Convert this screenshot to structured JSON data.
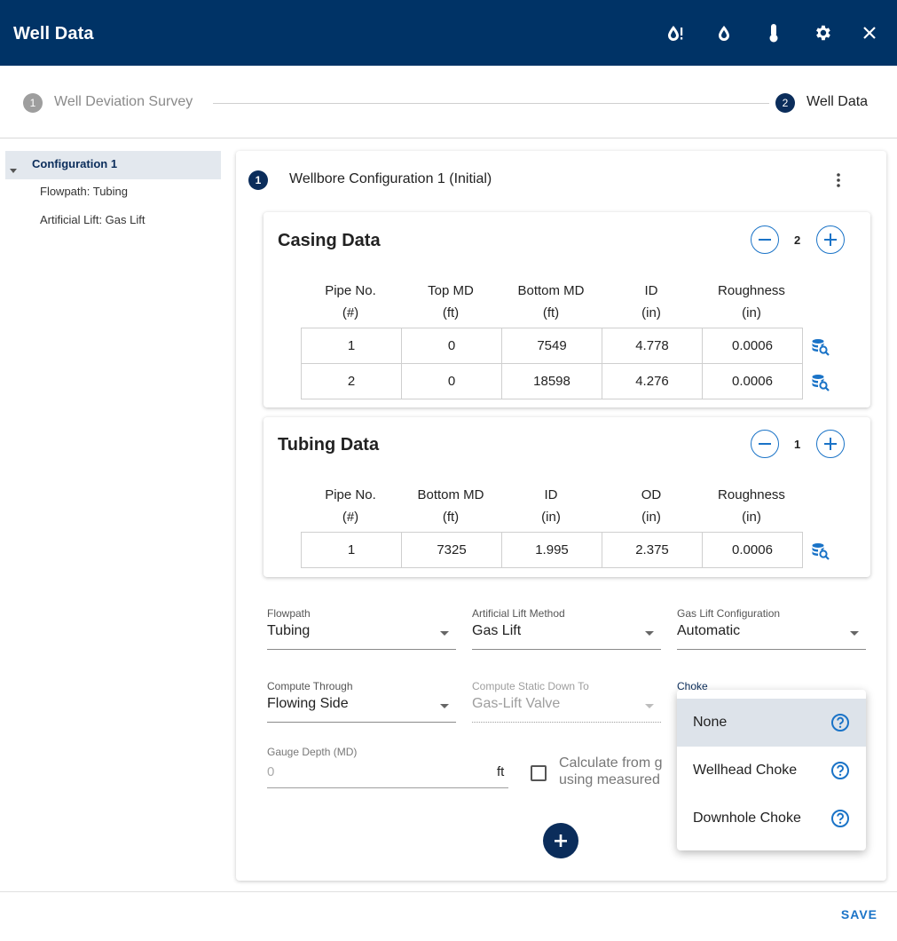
{
  "header": {
    "title": "Well Data",
    "icons": [
      "oil-alert-icon",
      "oil-drop-icon",
      "thermometer-icon",
      "gear-icon",
      "close-icon"
    ]
  },
  "stepper": {
    "steps": [
      {
        "number": "1",
        "label": "Well Deviation Survey",
        "active": false
      },
      {
        "number": "2",
        "label": "Well Data",
        "active": true
      }
    ]
  },
  "sidebar": {
    "root": "Configuration 1",
    "children": [
      "Flowpath: Tubing",
      "Artificial Lift: Gas Lift"
    ]
  },
  "config": {
    "number": "1",
    "title": "Wellbore Configuration 1 (Initial)"
  },
  "casing": {
    "title": "Casing Data",
    "count": "2",
    "columns": [
      {
        "name": "Pipe No.",
        "unit": "(#)"
      },
      {
        "name": "Top MD",
        "unit": "(ft)"
      },
      {
        "name": "Bottom MD",
        "unit": "(ft)"
      },
      {
        "name": "ID",
        "unit": "(in)"
      },
      {
        "name": "Roughness",
        "unit": "(in)"
      }
    ],
    "rows": [
      [
        "1",
        "0",
        "7549",
        "4.778",
        "0.0006"
      ],
      [
        "2",
        "0",
        "18598",
        "4.276",
        "0.0006"
      ]
    ]
  },
  "tubing": {
    "title": "Tubing Data",
    "count": "1",
    "columns": [
      {
        "name": "Pipe No.",
        "unit": "(#)"
      },
      {
        "name": "Bottom MD",
        "unit": "(ft)"
      },
      {
        "name": "ID",
        "unit": "(in)"
      },
      {
        "name": "OD",
        "unit": "(in)"
      },
      {
        "name": "Roughness",
        "unit": "(in)"
      }
    ],
    "rows": [
      [
        "1",
        "7325",
        "1.995",
        "2.375",
        "0.0006"
      ]
    ]
  },
  "form": {
    "flowpath": {
      "label": "Flowpath",
      "value": "Tubing"
    },
    "lift_method": {
      "label": "Artificial Lift Method",
      "value": "Gas Lift"
    },
    "gas_lift_config": {
      "label": "Gas Lift Configuration",
      "value": "Automatic"
    },
    "compute_through": {
      "label": "Compute Through",
      "value": "Flowing Side"
    },
    "compute_static": {
      "label": "Compute Static Down To",
      "value": "Gas-Lift Valve"
    },
    "choke": {
      "label": "Choke"
    },
    "gauge_depth": {
      "label": "Gauge Depth (MD)",
      "placeholder": "0",
      "unit": "ft"
    },
    "calc_checkbox": {
      "line1": "Calculate from g",
      "line2": "using measured"
    }
  },
  "choke_menu": {
    "options": [
      "None",
      "Wellhead Choke",
      "Downhole Choke"
    ],
    "selected": "None"
  },
  "footer": {
    "save_label": "SAVE"
  },
  "colors": {
    "brand": "#003366",
    "accent": "#1a73c7",
    "badge": "#0b2d5b"
  }
}
